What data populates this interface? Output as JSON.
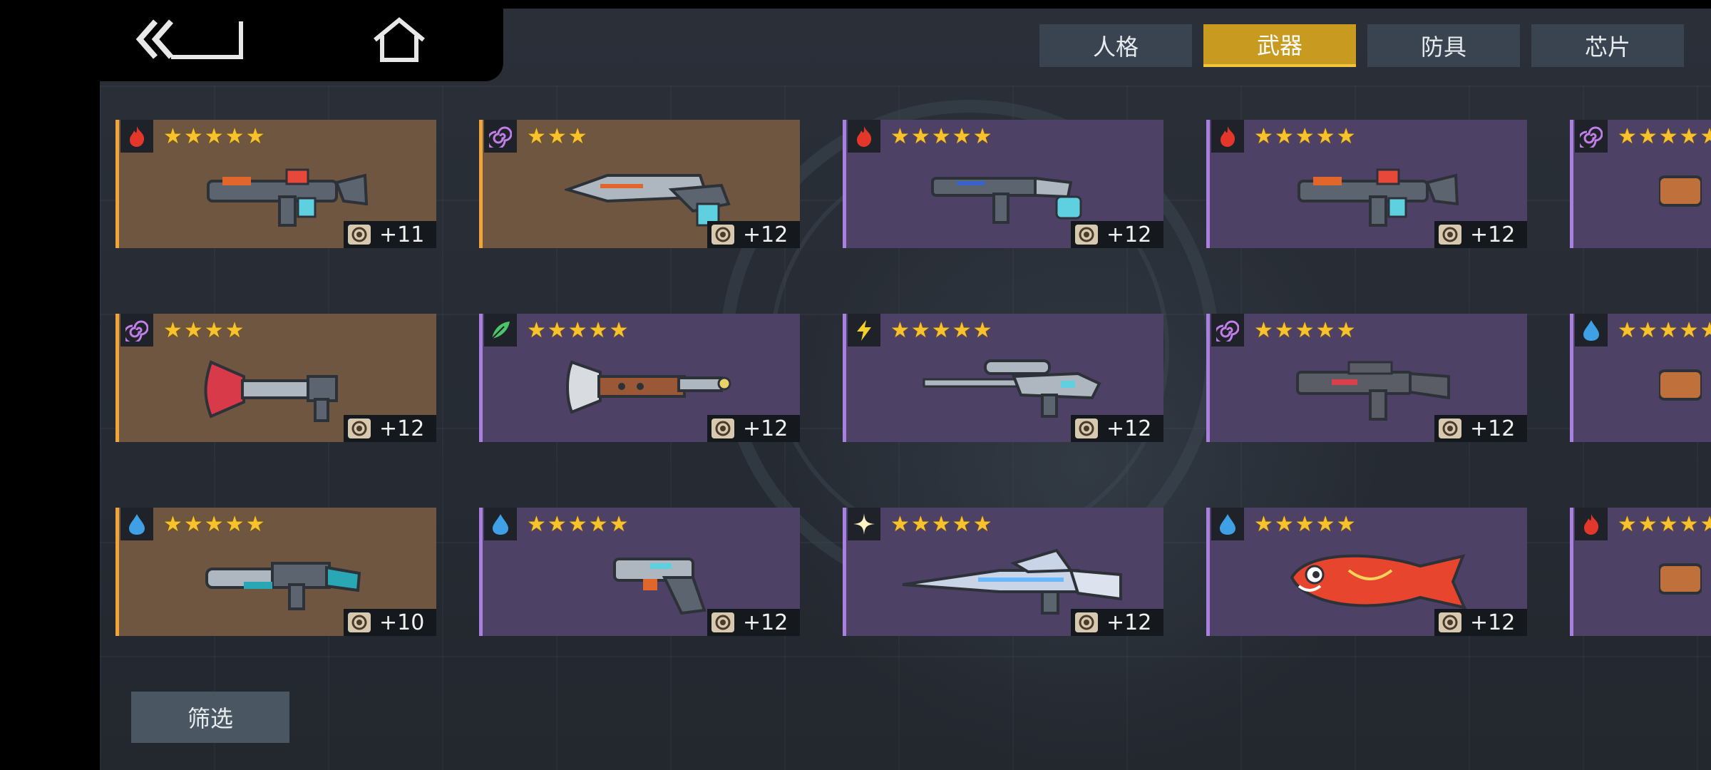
{
  "nav": {
    "back_icon": "back-icon",
    "home_icon": "home-icon"
  },
  "tabs": [
    {
      "label": "人格",
      "active": false
    },
    {
      "label": "武器",
      "active": true
    },
    {
      "label": "防具",
      "active": false
    },
    {
      "label": "芯片",
      "active": false
    }
  ],
  "filter_label": "筛选",
  "colors": {
    "gold_card": "#6e5640",
    "purple_card": "#4e4166",
    "gold_border": "#f1a43a",
    "purple_border": "#a97fe0",
    "tab_active": "#c99a20",
    "tab_inactive": "#3a4450",
    "star": "#f7c22b"
  },
  "weapons": [
    {
      "element": "fire",
      "stars": 5,
      "rarity": "gold",
      "level": "+11",
      "weapon": "assault-rifle"
    },
    {
      "element": "spiral",
      "stars": 3,
      "rarity": "gold",
      "level": "+12",
      "weapon": "heavy-rifle"
    },
    {
      "element": "fire",
      "stars": 5,
      "rarity": "purple",
      "level": "+12",
      "weapon": "smg"
    },
    {
      "element": "fire",
      "stars": 5,
      "rarity": "purple",
      "level": "+12",
      "weapon": "assault-rifle"
    },
    {
      "element": "spiral",
      "stars": 5,
      "rarity": "purple",
      "level": "",
      "weapon": "partial"
    },
    {
      "element": "spiral",
      "stars": 4,
      "rarity": "gold",
      "level": "+12",
      "weapon": "plunger-gun"
    },
    {
      "element": "leaf",
      "stars": 5,
      "rarity": "purple",
      "level": "+12",
      "weapon": "blunderbuss"
    },
    {
      "element": "bolt",
      "stars": 5,
      "rarity": "purple",
      "level": "+12",
      "weapon": "sniper-rifle"
    },
    {
      "element": "spiral",
      "stars": 5,
      "rarity": "purple",
      "level": "+12",
      "weapon": "carbine"
    },
    {
      "element": "water",
      "stars": 5,
      "rarity": "purple",
      "level": "",
      "weapon": "partial"
    },
    {
      "element": "water",
      "stars": 5,
      "rarity": "gold",
      "level": "+10",
      "weapon": "launcher"
    },
    {
      "element": "water",
      "stars": 5,
      "rarity": "purple",
      "level": "+12",
      "weapon": "pistol"
    },
    {
      "element": "star",
      "stars": 5,
      "rarity": "purple",
      "level": "+12",
      "weapon": "railgun"
    },
    {
      "element": "water",
      "stars": 5,
      "rarity": "purple",
      "level": "+12",
      "weapon": "koi-fish"
    },
    {
      "element": "fire",
      "stars": 5,
      "rarity": "purple",
      "level": "",
      "weapon": "partial"
    }
  ]
}
